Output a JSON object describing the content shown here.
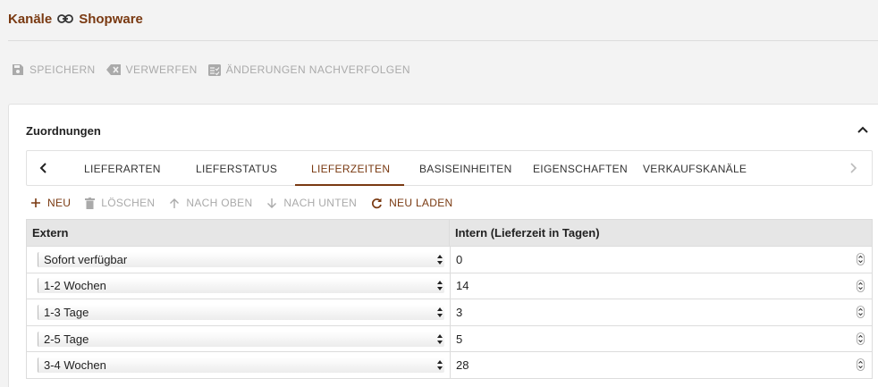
{
  "header": {
    "title_left": "Kanäle",
    "title_right": "Shopware"
  },
  "toolbar": {
    "save": "SPEICHERN",
    "discard": "VERWERFEN",
    "track": "ÄNDERUNGEN NACHVERFOLGEN"
  },
  "panel": {
    "title": "Zuordnungen"
  },
  "tabs": [
    {
      "label": "LIEFERARTEN"
    },
    {
      "label": "LIEFERSTATUS"
    },
    {
      "label": "LIEFERZEITEN"
    },
    {
      "label": "BASISEINHEITEN"
    },
    {
      "label": "EIGENSCHAFTEN"
    },
    {
      "label": "VERKAUFSKANÄLE"
    }
  ],
  "active_tab": "LIEFERZEITEN",
  "actions": {
    "new": "NEU",
    "delete": "LÖSCHEN",
    "up": "NACH OBEN",
    "down": "NACH UNTEN",
    "reload": "NEU LADEN"
  },
  "table": {
    "headers": [
      "Extern",
      "Intern (Lieferzeit in Tagen)"
    ],
    "rows": [
      {
        "extern": "Sofort verfügbar",
        "intern": "0"
      },
      {
        "extern": "1-2 Wochen",
        "intern": "14"
      },
      {
        "extern": "1-3 Tage",
        "intern": "3"
      },
      {
        "extern": "2-5 Tage",
        "intern": "5"
      },
      {
        "extern": "3-4 Wochen",
        "intern": "28"
      }
    ]
  },
  "colors": {
    "accent": "#7a3a12",
    "disabled": "#aaaaaa"
  }
}
